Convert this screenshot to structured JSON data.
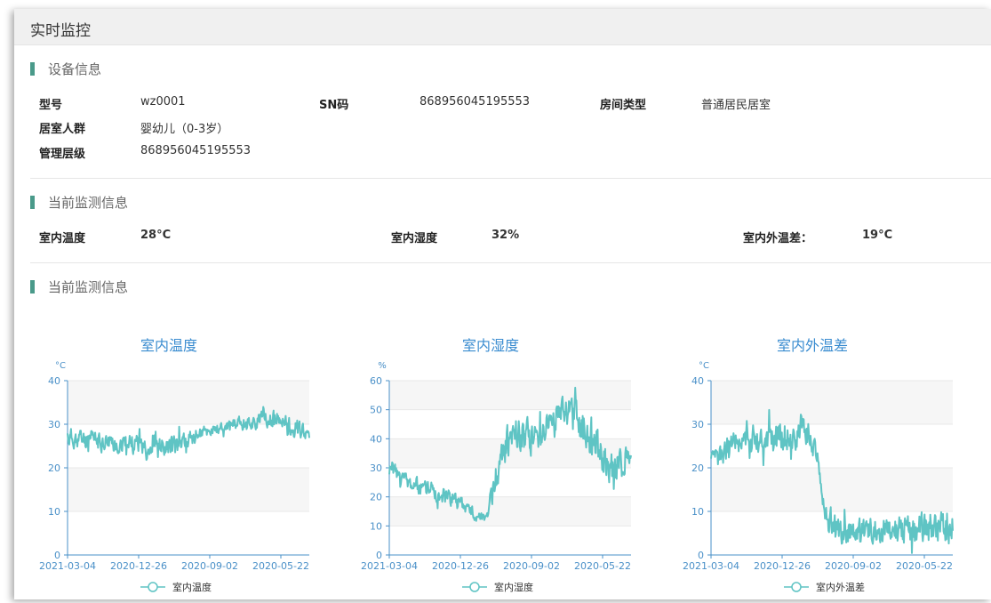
{
  "header": {
    "title": "实时监控"
  },
  "device": {
    "section_title": "设备信息",
    "model_label": "型号",
    "model_value": "wz0001",
    "sn_label": "SN码",
    "sn_value": "868956045195553",
    "room_type_label": "房间类型",
    "room_type_value": "普通居民居室",
    "resident_label": "居室人群",
    "resident_value": "婴幼儿（0-3岁）",
    "level_label": "管理层级",
    "level_value": "868956045195553"
  },
  "monitor": {
    "section_title": "当前监测信息",
    "indoor_temp_label": "室内温度",
    "indoor_temp_value": "28°C",
    "indoor_humidity_label": "室内湿度",
    "indoor_humidity_value": "32%",
    "temp_diff_label": "室内外温差：",
    "temp_diff_value": "19°C"
  },
  "charts_section": {
    "section_title": "当前监测信息"
  },
  "colors": {
    "series": "#5fc4c4",
    "axis": "#4a90c8",
    "title": "#3a8cd0",
    "accent_bar": "#4a9a8a"
  },
  "chart_data": [
    {
      "type": "line",
      "title": "室内温度",
      "unit": "°C",
      "ylim": [
        0,
        40
      ],
      "yticks": [
        0,
        10,
        20,
        30,
        40
      ],
      "xticks": [
        "2021-03-04",
        "2020-12-26",
        "2020-09-02",
        "2020-05-22"
      ],
      "legend": "室内温度",
      "seed": 11,
      "profile": [
        [
          0,
          27,
          3
        ],
        [
          0.15,
          26,
          3
        ],
        [
          0.35,
          25,
          3
        ],
        [
          0.45,
          25,
          3
        ],
        [
          0.55,
          28,
          2
        ],
        [
          0.7,
          30,
          2
        ],
        [
          0.85,
          31,
          3
        ],
        [
          1,
          28,
          3
        ]
      ]
    },
    {
      "type": "line",
      "title": "室内湿度",
      "unit": "%",
      "ylim": [
        0,
        60
      ],
      "yticks": [
        0,
        10,
        20,
        30,
        40,
        50,
        60
      ],
      "xticks": [
        "2021-03-04",
        "2020-12-26",
        "2020-09-02",
        "2020-05-22"
      ],
      "legend": "室内湿度",
      "seed": 23,
      "profile": [
        [
          0,
          30,
          3
        ],
        [
          0.1,
          24,
          4
        ],
        [
          0.25,
          20,
          4
        ],
        [
          0.35,
          14,
          3
        ],
        [
          0.4,
          13,
          2
        ],
        [
          0.45,
          30,
          8
        ],
        [
          0.5,
          42,
          8
        ],
        [
          0.6,
          40,
          8
        ],
        [
          0.7,
          50,
          6
        ],
        [
          0.8,
          45,
          9
        ],
        [
          0.9,
          32,
          10
        ],
        [
          1,
          30,
          8
        ]
      ]
    },
    {
      "type": "line",
      "title": "室内外温差",
      "unit": "°C",
      "ylim": [
        0,
        40
      ],
      "yticks": [
        0,
        10,
        20,
        30,
        40
      ],
      "xticks": [
        "2021-03-04",
        "2020-12-26",
        "2020-09-02",
        "2020-05-22"
      ],
      "legend": "室内外温差",
      "seed": 37,
      "profile": [
        [
          0,
          21,
          3
        ],
        [
          0.1,
          26,
          4
        ],
        [
          0.25,
          27,
          5
        ],
        [
          0.4,
          28,
          4
        ],
        [
          0.44,
          22,
          3
        ],
        [
          0.47,
          9,
          4
        ],
        [
          0.55,
          5,
          4
        ],
        [
          0.7,
          6,
          4
        ],
        [
          0.85,
          6,
          5
        ],
        [
          1,
          6,
          5
        ]
      ]
    }
  ]
}
